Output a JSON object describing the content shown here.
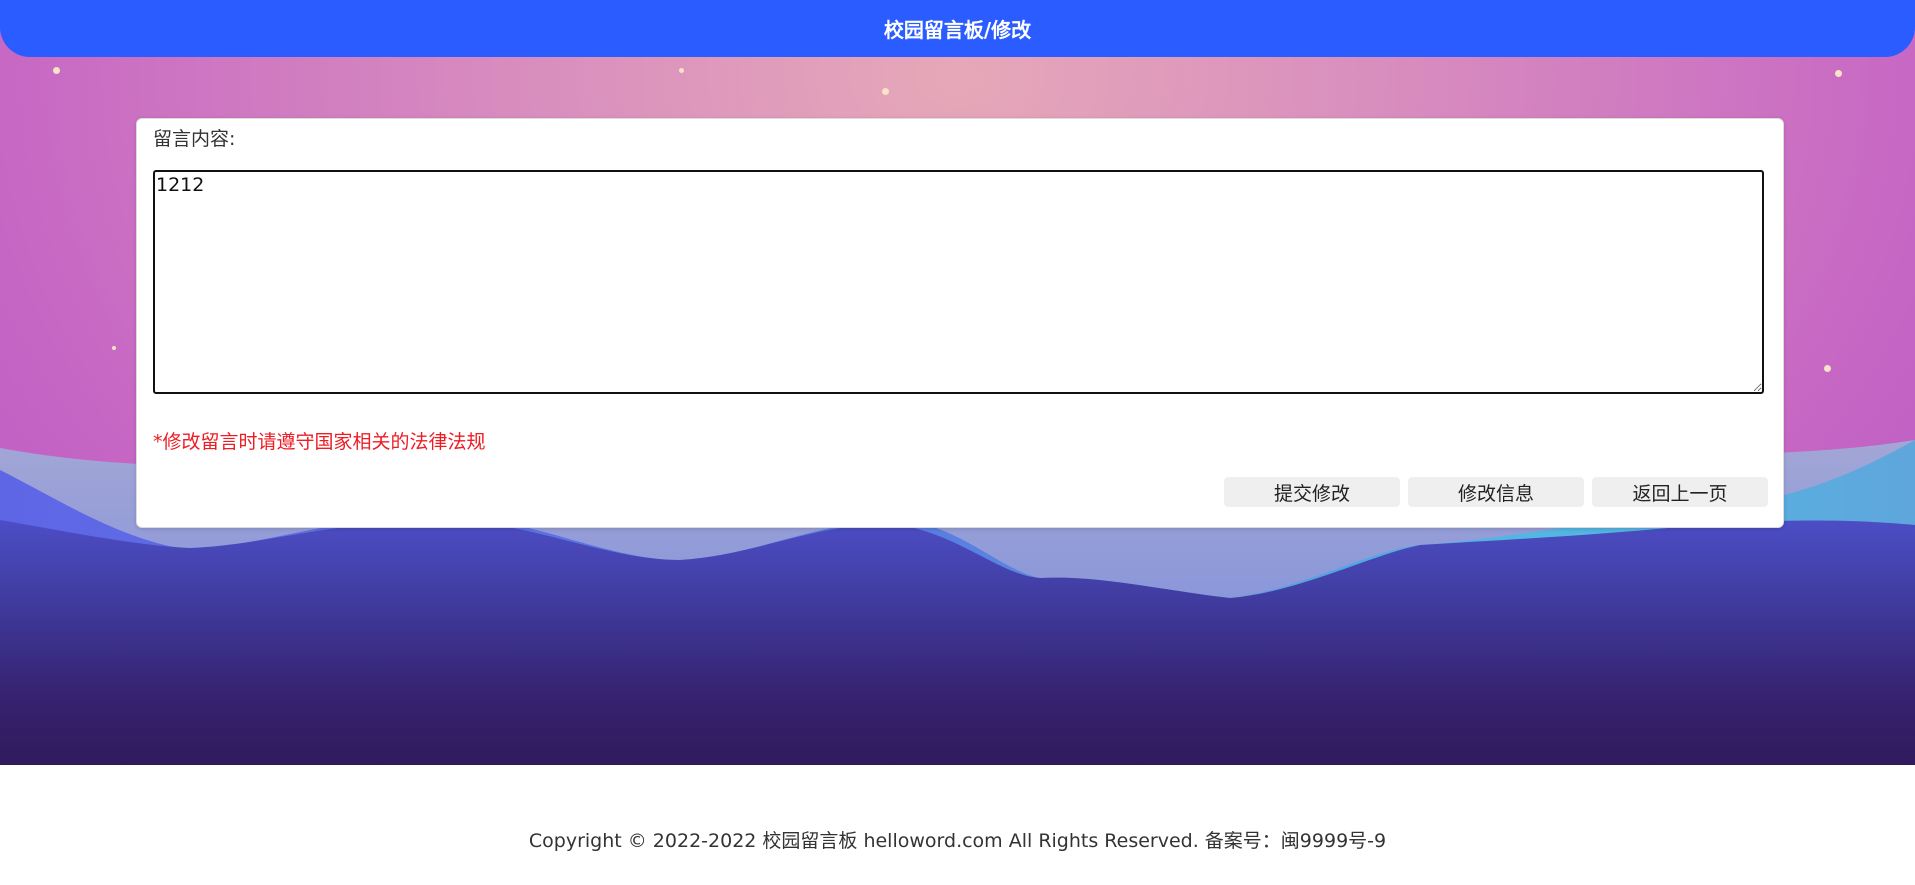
{
  "header": {
    "title": "校园留言板/修改"
  },
  "form": {
    "content_label": "留言内容:",
    "content_value": "1212",
    "warning": "*修改留言时请遵守国家相关的法律法规"
  },
  "buttons": {
    "submit_label": "提交修改",
    "modify_info_label": "修改信息",
    "back_label": "返回上一页"
  },
  "footer": {
    "copyright": "Copyright © 2022-2022 校园留言板 helloword.com All Rights Reserved. 备案号：闽9999号-9"
  },
  "colors": {
    "header_bg": "#2a5cff",
    "warning_text": "#ee1c25"
  }
}
